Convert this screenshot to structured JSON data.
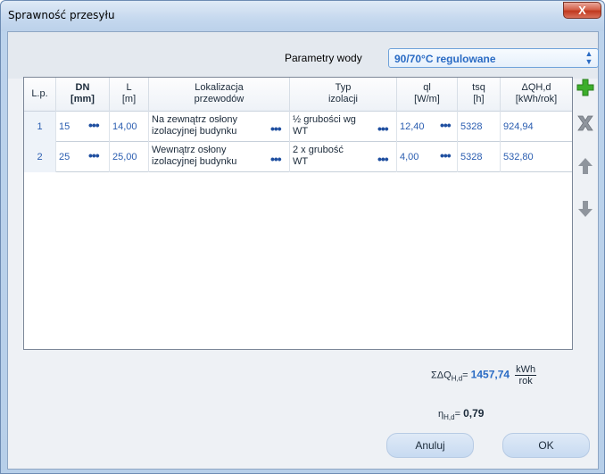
{
  "window": {
    "title": "Sprawność przesyłu",
    "close_label": "X"
  },
  "parameters": {
    "label": "Parametry wody",
    "selected": "90/70°C regulowane"
  },
  "table": {
    "headers": [
      {
        "line1": "L.p.",
        "line2": ""
      },
      {
        "line1": "DN",
        "line2": "[mm]"
      },
      {
        "line1": "L",
        "line2": "[m]"
      },
      {
        "line1": "Lokalizacja",
        "line2": "przewodów"
      },
      {
        "line1": "Typ",
        "line2": "izolacji"
      },
      {
        "line1": "ql",
        "line2": "[W/m]"
      },
      {
        "line1": "tsq",
        "line2": "[h]"
      },
      {
        "line1": "ΔQH,d",
        "line2": "[kWh/rok]"
      }
    ],
    "rows": [
      {
        "lp": "1",
        "dn": "15",
        "l": "14,00",
        "lokalizacja": [
          "Na zewnątrz osłony",
          "izolacyjnej budynku"
        ],
        "typ": [
          "½ grubości wg",
          "WT"
        ],
        "ql": "12,40",
        "tsq": "5328",
        "dq": "924,94"
      },
      {
        "lp": "2",
        "dn": "25",
        "l": "25,00",
        "lokalizacja": [
          "Wewnątrz osłony",
          "izolacyjnej budynku"
        ],
        "typ": [
          "2 x grubość",
          "WT"
        ],
        "ql": "4,00",
        "tsq": "5328",
        "dq": "532,80"
      }
    ],
    "ellipsis": "•••"
  },
  "summary": {
    "sum_prefix": "ΣΔQ",
    "sum_sub": "H,d",
    "sum_eq": "=",
    "sum_value": "1457,74",
    "unit_num": "kWh",
    "unit_den": "rok",
    "eta_prefix": "η",
    "eta_sub": "H,d",
    "eta_eq": "=",
    "eta_value": "0,79"
  },
  "buttons": {
    "cancel": "Anuluj",
    "ok": "OK"
  },
  "colors": {
    "accent": "#2a6bc4",
    "add": "#3cae2b",
    "delete": "#8f959d",
    "arrow": "#8f959d"
  }
}
